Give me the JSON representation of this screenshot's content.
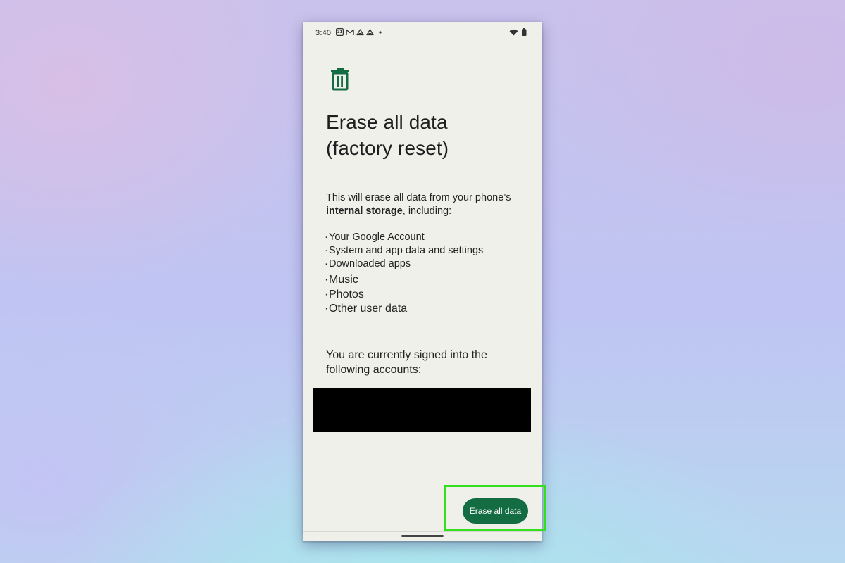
{
  "status_bar": {
    "time": "3:40",
    "calendar_day": "31",
    "left_icons": [
      "calendar-icon",
      "gmail-icon",
      "drive-icon",
      "drive-icon",
      "dot-icon"
    ],
    "right_icons": [
      "wifi-icon",
      "battery-icon"
    ]
  },
  "header": {
    "icon": "trash-icon",
    "title_line1": "Erase all data",
    "title_line2": "(factory reset)"
  },
  "intro": {
    "text_before": "This will erase all data from your phone’s",
    "bold": "internal storage",
    "text_after": ", including:"
  },
  "data_items": [
    "Your Google Account",
    "System and app data and settings",
    "Downloaded apps",
    "Music",
    "Photos",
    "Other user data"
  ],
  "accounts": {
    "text_line1": "You are currently signed into the",
    "text_line2": "following accounts:"
  },
  "actions": {
    "erase_label": "Erase all data"
  },
  "colors": {
    "accent": "#146c43",
    "highlight": "#33e01d",
    "screen_bg": "#f0f0ea"
  }
}
